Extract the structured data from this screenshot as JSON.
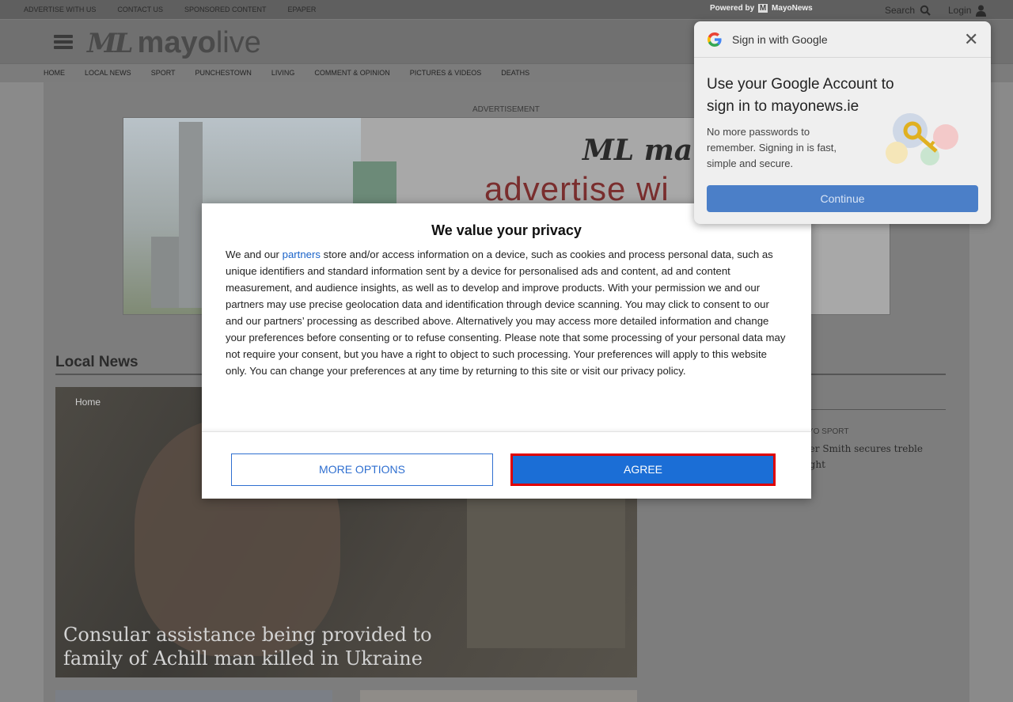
{
  "topbar": {
    "links": [
      "ADVERTISE WITH US",
      "CONTACT US",
      "SPONSORED CONTENT",
      "EPAPER"
    ],
    "powered_by": "Powered by",
    "powered_brand": "MayoNews",
    "search_label": "Search",
    "login_label": "Login"
  },
  "header": {
    "logo_mark": "ML",
    "logo_word_bold": "mayo",
    "logo_word": "live"
  },
  "nav": {
    "items": [
      "HOME",
      "LOCAL NEWS",
      "SPORT",
      "PUNCHESTOWN",
      "LIVING",
      "COMMENT & OPINION",
      "PICTURES & VIDEOS",
      "DEATHS"
    ]
  },
  "advert": {
    "label": "ADVERTISEMENT",
    "logo_text": "ML ma",
    "tagline": "advertise wi"
  },
  "section": {
    "title": "Local News",
    "side_category": "AYO SPORT",
    "side_title": "per Smith secures treble light"
  },
  "hero": {
    "crumb": "Home",
    "headline": "Consular assistance being provided to family of Achill man killed in Ukraine"
  },
  "consent": {
    "title": "We value your privacy",
    "body_pre": "We and our ",
    "partners_link": "partners",
    "body_post": " store and/or access information on a device, such as cookies and process personal data, such as unique identifiers and standard information sent by a device for personalised ads and content, ad and content measurement, and audience insights, as well as to develop and improve products. With your permission we and our partners may use precise geolocation data and identification through device scanning. You may click to consent to our and our partners’ processing as described above. Alternatively you may access more detailed information and change your preferences before consenting or to refuse consenting. Please note that some processing of your personal data may not require your consent, but you have a right to object to such processing. Your preferences will apply to this website only. You can change your preferences at any time by returning to this site or visit our privacy policy.",
    "more_options_label": "MORE OPTIONS",
    "agree_label": "AGREE"
  },
  "google": {
    "header_title": "Sign in with Google",
    "headline": "Use your Google Account to sign in to mayonews.ie",
    "description": "No more passwords to remember. Signing in is fast, simple and secure.",
    "continue_label": "Continue"
  }
}
